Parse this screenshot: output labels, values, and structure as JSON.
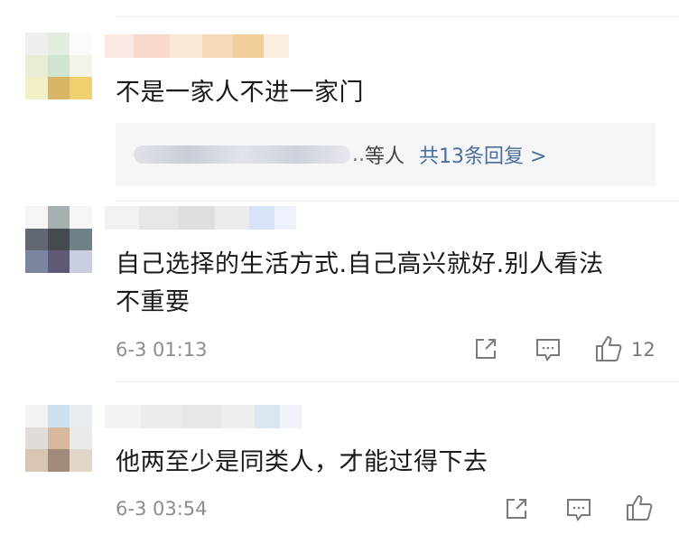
{
  "comments": [
    {
      "text": "不是一家人不进一家门",
      "replies": {
        "suffix": "等人",
        "link_label": "共13条回复 >"
      }
    },
    {
      "text_line1": "自己选择的生活方式.自己高兴就好.别人看法",
      "text_line2": "不重要",
      "time": "6-3 01:13",
      "like_count": "12",
      "icons": [
        "share-icon",
        "comment-icon",
        "like-icon"
      ]
    },
    {
      "text": "他两至少是同类人，才能过得下去",
      "time": "6-3 03:54",
      "icons": [
        "share-icon",
        "comment-icon",
        "like-icon"
      ]
    }
  ],
  "colors": {
    "link": "#4a6f9a",
    "meta": "#8d8d8d",
    "reply_bg": "#f5f6f8"
  }
}
